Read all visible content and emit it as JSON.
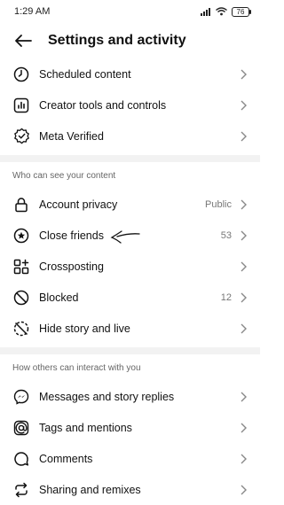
{
  "status_bar": {
    "time": "1:29 AM",
    "battery": "76"
  },
  "header": {
    "title": "Settings and activity"
  },
  "group1": [
    {
      "name": "scheduled-content",
      "icon": "clock-icon",
      "label": "Scheduled content",
      "value": ""
    },
    {
      "name": "creator-tools",
      "icon": "bar-chart-icon",
      "label": "Creator tools and controls",
      "value": ""
    },
    {
      "name": "meta-verified",
      "icon": "verified-badge-icon",
      "label": "Meta Verified",
      "value": ""
    }
  ],
  "section1": {
    "title": "Who can see your content"
  },
  "group2": [
    {
      "name": "account-privacy",
      "icon": "lock-icon",
      "label": "Account privacy",
      "value": "Public"
    },
    {
      "name": "close-friends",
      "icon": "star-circle-icon",
      "label": "Close friends",
      "value": "53"
    },
    {
      "name": "crossposting",
      "icon": "grid-plus-icon",
      "label": "Crossposting",
      "value": ""
    },
    {
      "name": "blocked",
      "icon": "blocked-icon",
      "label": "Blocked",
      "value": "12"
    },
    {
      "name": "hide-story",
      "icon": "hide-story-icon",
      "label": "Hide story and live",
      "value": ""
    }
  ],
  "section2": {
    "title": "How others can interact with you"
  },
  "group3": [
    {
      "name": "messages-replies",
      "icon": "messenger-icon",
      "label": "Messages and story replies",
      "value": ""
    },
    {
      "name": "tags-mentions",
      "icon": "at-sign-icon",
      "label": "Tags and mentions",
      "value": ""
    },
    {
      "name": "comments",
      "icon": "comment-icon",
      "label": "Comments",
      "value": ""
    },
    {
      "name": "sharing-remixes",
      "icon": "repost-icon",
      "label": "Sharing and remixes",
      "value": ""
    }
  ]
}
